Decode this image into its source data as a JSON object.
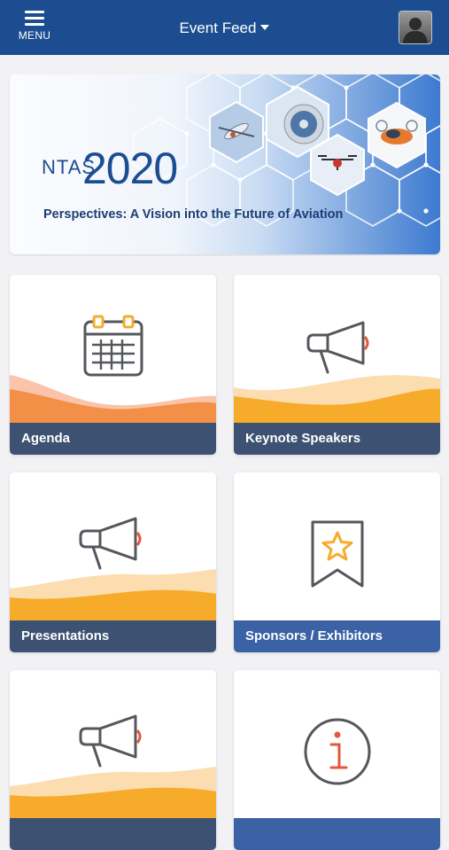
{
  "header": {
    "menu_label": "MENU",
    "title": "Event Feed"
  },
  "banner": {
    "logo_letters": "NTAS",
    "logo_year": "2020",
    "tagline": "Perspectives: A Vision into the Future of Aviation"
  },
  "tiles": [
    {
      "label": "Agenda",
      "icon": "calendar-icon"
    },
    {
      "label": "Keynote Speakers",
      "icon": "megaphone-icon"
    },
    {
      "label": "Presentations",
      "icon": "megaphone-icon"
    },
    {
      "label": "Sponsors / Exhibitors",
      "icon": "ribbon-star-icon"
    },
    {
      "label": "",
      "icon": "megaphone-icon"
    },
    {
      "label": "",
      "icon": "info-icon"
    }
  ],
  "colors": {
    "header": "#1d4d91",
    "label_slate": "#3d5272",
    "label_blue": "#3a62a5",
    "orange": "#f28a3c",
    "amber": "#f6ab2a",
    "icon_red": "#e4573a",
    "icon_gray": "#54575c"
  }
}
